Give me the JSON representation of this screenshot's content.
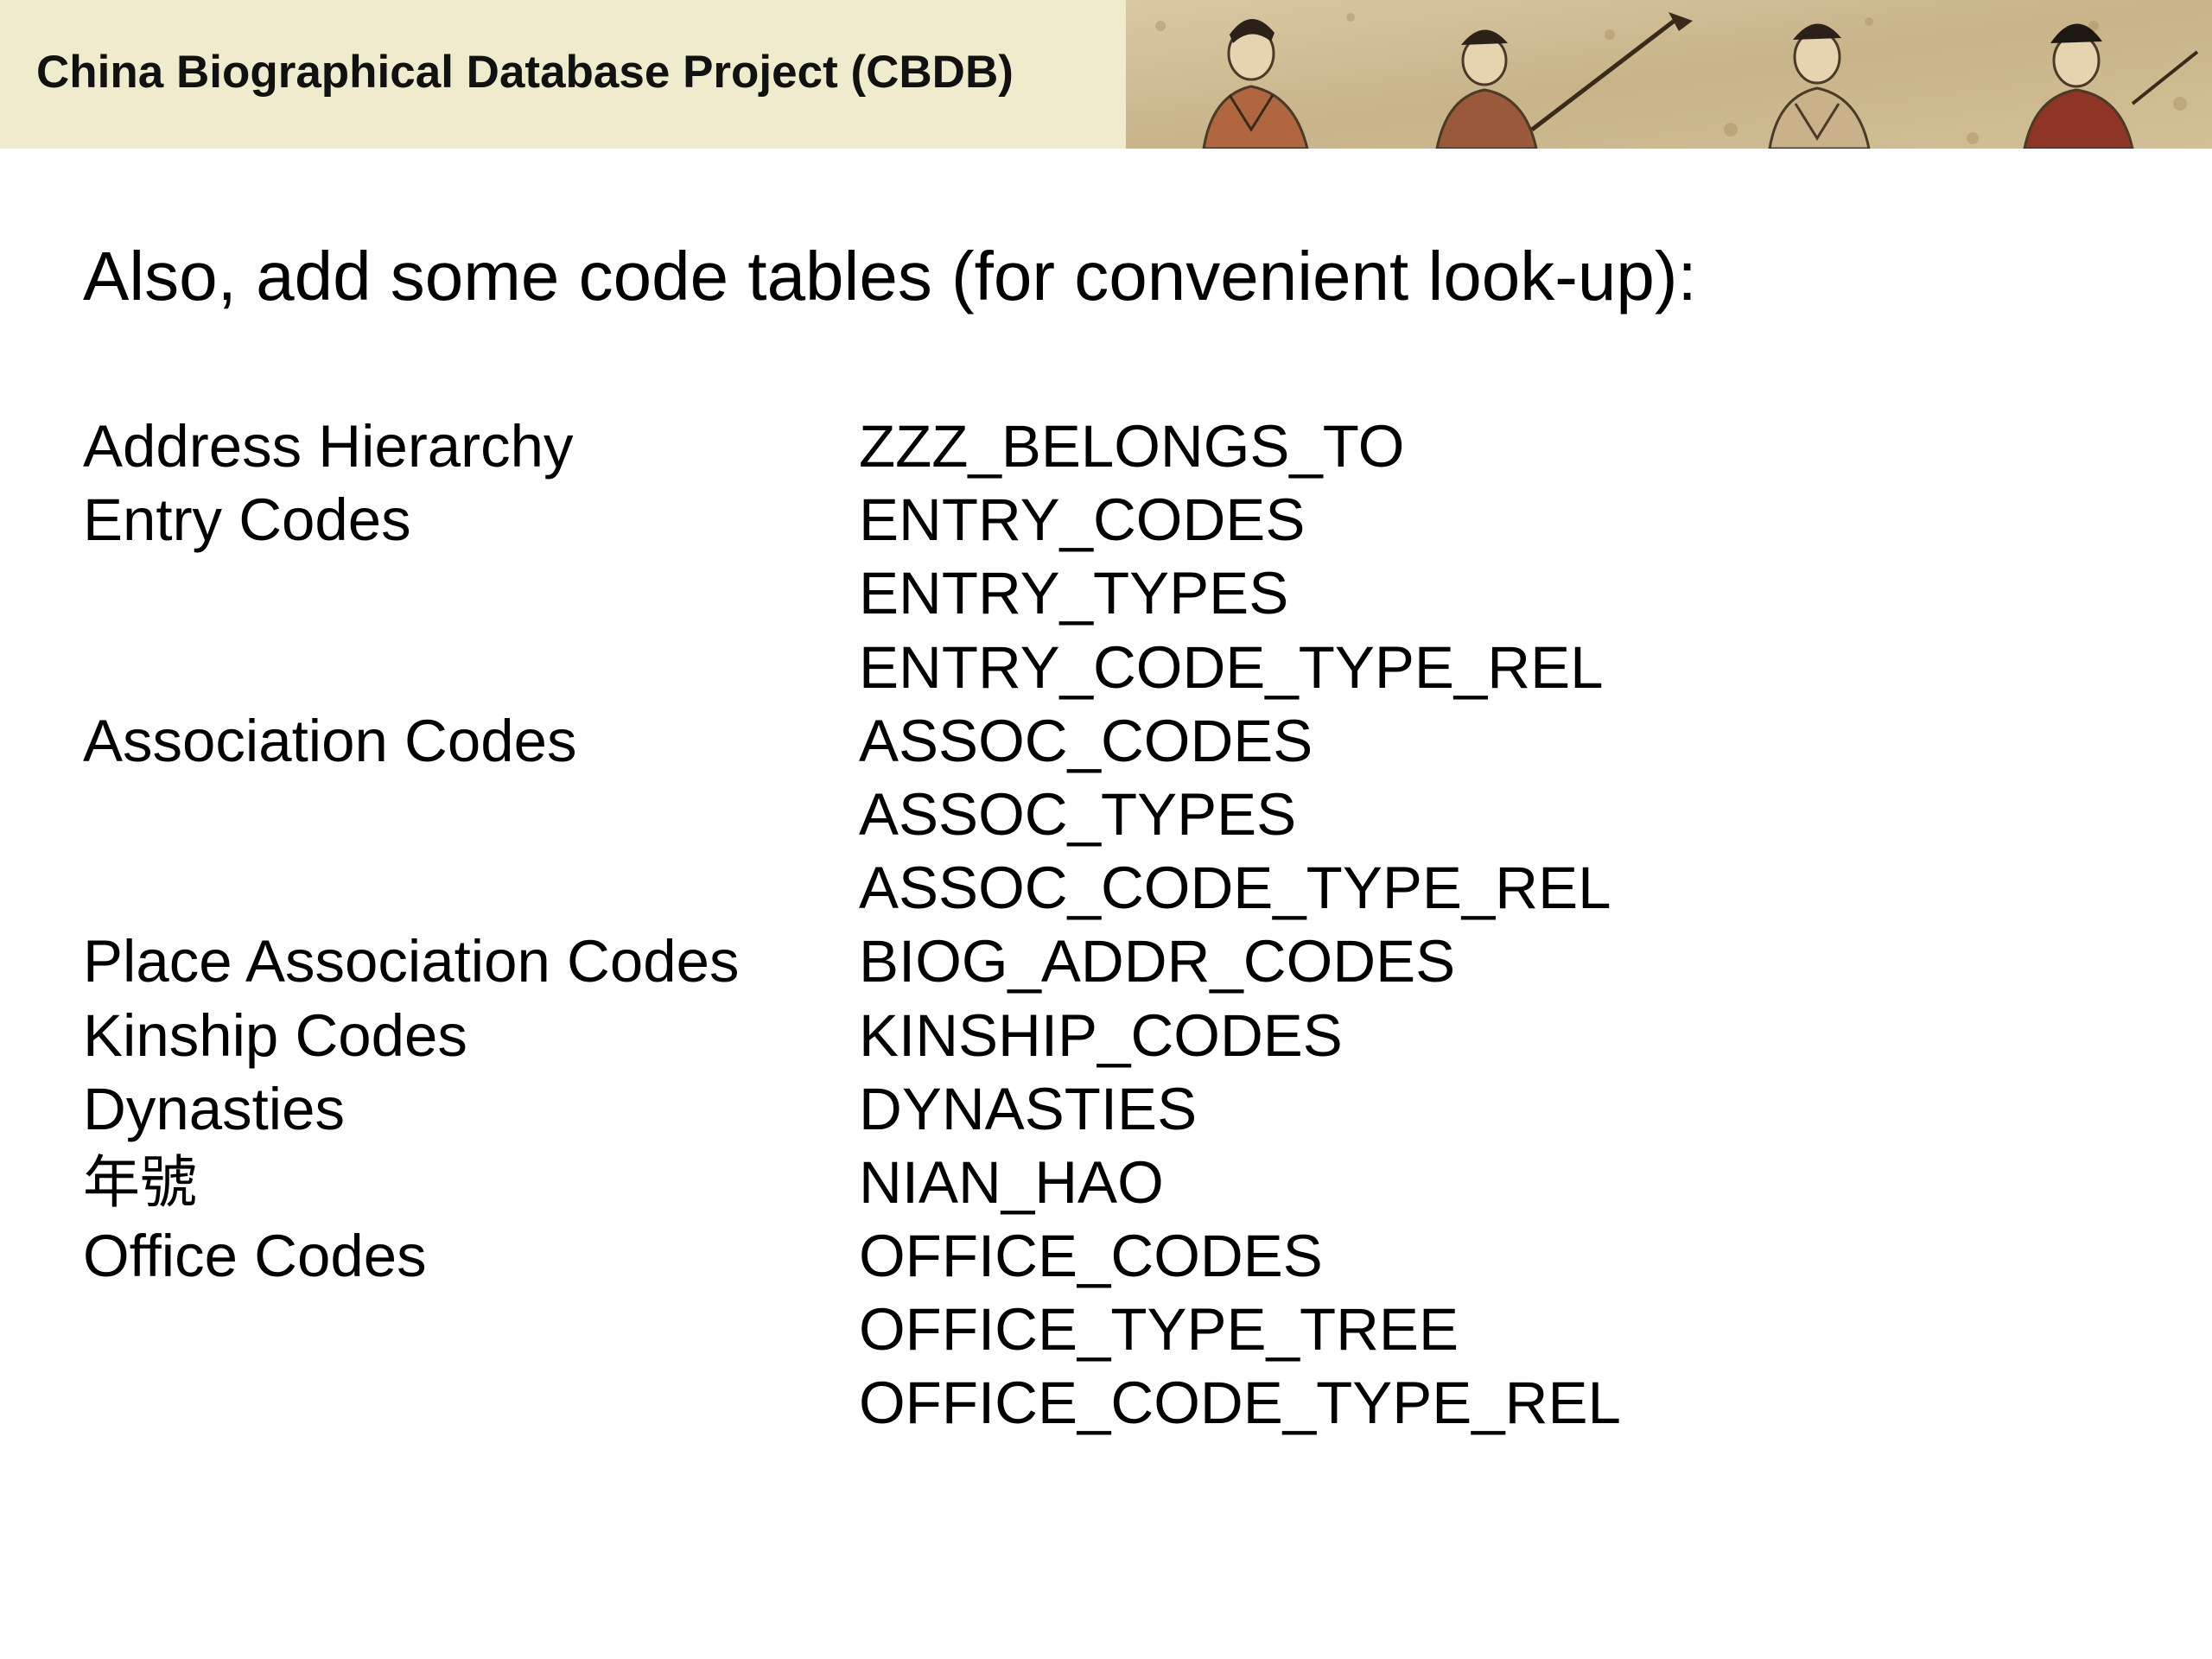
{
  "banner": {
    "title": "China Biographical Database Project (CBDB)",
    "image": "banner-painting-figures"
  },
  "heading": "Also, add some code tables (for convenient look-up):",
  "code_tables": [
    {
      "label": "Address Hierarchy",
      "table": "ZZZ_BELONGS_TO"
    },
    {
      "label": "Entry Codes",
      "table": "ENTRY_CODES"
    },
    {
      "label": "",
      "table": "ENTRY_TYPES"
    },
    {
      "label": "",
      "table": "ENTRY_CODE_TYPE_REL"
    },
    {
      "label": "Association Codes",
      "table": "ASSOC_CODES"
    },
    {
      "label": "",
      "table": "ASSOC_TYPES"
    },
    {
      "label": "",
      "table": "ASSOC_CODE_TYPE_REL"
    },
    {
      "label": "Place Association Codes",
      "table": "BIOG_ADDR_CODES"
    },
    {
      "label": "Kinship Codes",
      "table": "KINSHIP_CODES"
    },
    {
      "label": "Dynasties",
      "table": "DYNASTIES"
    },
    {
      "label": "年號",
      "table": "NIAN_HAO"
    },
    {
      "label": "Office Codes",
      "table": "OFFICE_CODES"
    },
    {
      "label": "",
      "table": "OFFICE_TYPE_TREE"
    },
    {
      "label": "",
      "table": "OFFICE_CODE_TYPE_REL"
    }
  ]
}
